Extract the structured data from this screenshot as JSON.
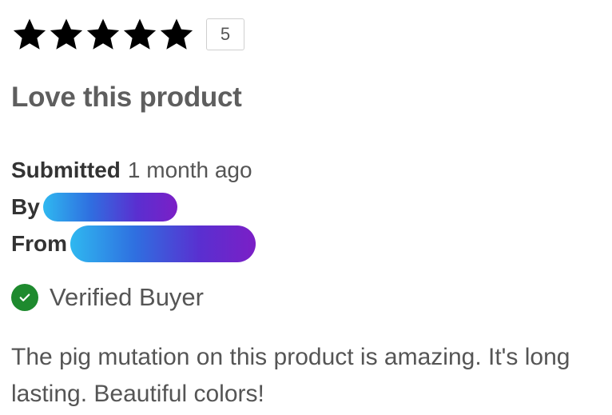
{
  "review": {
    "rating": 5,
    "rating_max": 5,
    "rating_badge": "5",
    "title": "Love this product",
    "submitted_label": "Submitted",
    "submitted_value": "1 month ago",
    "by_label": "By",
    "from_label": "From",
    "verified_label": "Verified Buyer",
    "body": "The pig mutation on this product is amazing. It's long lasting. Beautiful colors!"
  },
  "colors": {
    "star": "#000000",
    "verified_badge": "#1e8a2e",
    "redaction_gradient": [
      "#2fb8f0",
      "#2f6fe0",
      "#5a2fd0",
      "#7b1fc6"
    ]
  }
}
